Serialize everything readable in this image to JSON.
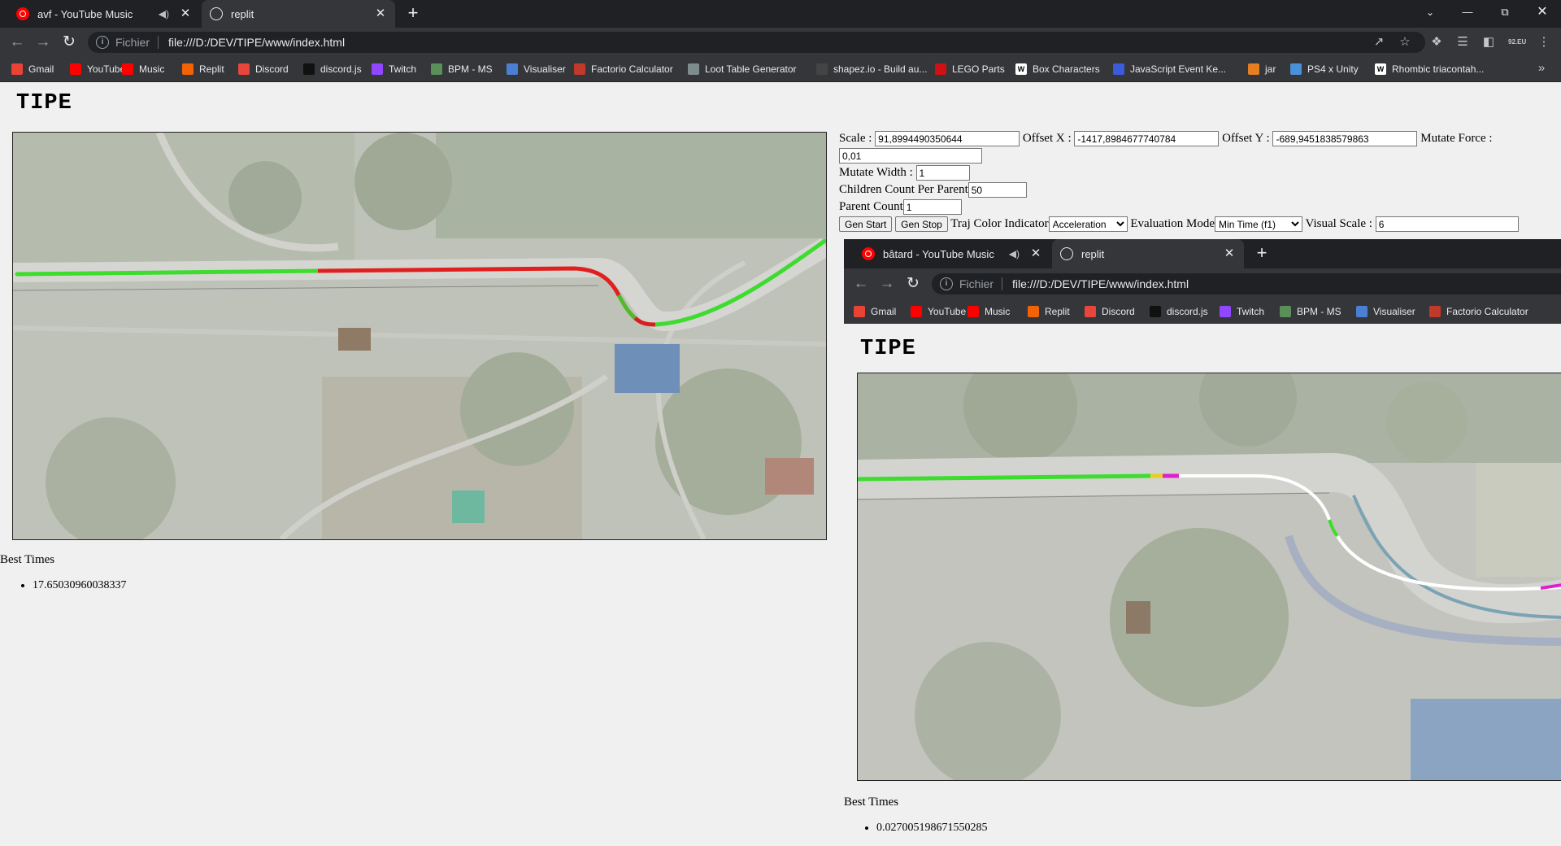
{
  "browser": {
    "tabs": [
      {
        "title": "avf - YouTube Music",
        "active": false
      },
      {
        "title": "replit",
        "active": true
      }
    ],
    "address": {
      "scheme": "Fichier",
      "url": "file:///D:/DEV/TIPE/www/index.html"
    },
    "bookmarks": [
      {
        "label": "Gmail",
        "icon": "gmail-icon",
        "color": "#ea4335"
      },
      {
        "label": "YouTube",
        "icon": "youtube-icon",
        "color": "#ff0000"
      },
      {
        "label": "Music",
        "icon": "youtube-music-icon",
        "color": "#ff0000"
      },
      {
        "label": "Replit",
        "icon": "replit-icon",
        "color": "#f26207"
      },
      {
        "label": "Discord",
        "icon": "discord-icon",
        "color": "#e8453c"
      },
      {
        "label": "discord.js",
        "icon": "discordjs-icon",
        "color": "#111111"
      },
      {
        "label": "Twitch",
        "icon": "twitch-icon",
        "color": "#9146ff"
      },
      {
        "label": "BPM - MS",
        "icon": "bpm-icon",
        "color": "#5a8f5a"
      },
      {
        "label": "Visualiser",
        "icon": "visualiser-icon",
        "color": "#4a7fd4"
      },
      {
        "label": "Factorio Calculator",
        "icon": "factorio-icon",
        "color": "#c0392b"
      },
      {
        "label": "Loot Table Generator",
        "icon": "loot-icon",
        "color": "#7f8c8d"
      },
      {
        "label": "shapez.io - Build au...",
        "icon": "shapez-icon",
        "color": "#444444"
      },
      {
        "label": "LEGO Parts",
        "icon": "lego-icon",
        "color": "#d01012"
      },
      {
        "label": "Box Characters",
        "icon": "wiki-icon",
        "color": "#ffffff"
      },
      {
        "label": "JavaScript Event Ke...",
        "icon": "js-event-icon",
        "color": "#3b5bdb"
      },
      {
        "label": "jar",
        "icon": "jar-icon",
        "color": "#e67e22"
      },
      {
        "label": "PS4 x Unity",
        "icon": "wordpress-icon",
        "color": "#4a90d9"
      },
      {
        "label": "Rhombic triacontah...",
        "icon": "wiki-icon",
        "color": "#ffffff"
      }
    ]
  },
  "page": {
    "title": "TIPE",
    "best_times_label": "Best Times",
    "best_times": [
      "17.65030960038337"
    ]
  },
  "controls": {
    "scale_label": "Scale :",
    "scale_value": "91,8994490350644",
    "offset_x_label": "Offset X :",
    "offset_x_value": "-1417,8984677740784",
    "offset_y_label": "Offset Y :",
    "offset_y_value": "-689,9451838579863",
    "mutate_force_label": "Mutate Force :",
    "mutate_force_value": "0,01",
    "mutate_width_label": "Mutate Width :",
    "mutate_width_value": "1",
    "children_label": "Children Count Per Parent",
    "children_value": "50",
    "parent_label": "Parent Count",
    "parent_value": "1",
    "gen_start": "Gen Start",
    "gen_stop": "Gen Stop",
    "traj_label": "Traj Color Indicator",
    "traj_value": "Acceleration",
    "eval_label": "Evaluation Mode",
    "eval_value": "Min Time (f1)",
    "visual_scale_label": "Visual Scale :",
    "visual_scale_value": "6"
  },
  "nested": {
    "tabs": [
      {
        "title": "bâtard - YouTube Music",
        "active": false
      },
      {
        "title": "replit",
        "active": true
      }
    ],
    "address": {
      "scheme": "Fichier",
      "url": "file:///D:/DEV/TIPE/www/index.html"
    },
    "bookmarks": [
      {
        "label": "Gmail",
        "icon": "gmail-icon",
        "color": "#ea4335"
      },
      {
        "label": "YouTube",
        "icon": "youtube-icon",
        "color": "#ff0000"
      },
      {
        "label": "Music",
        "icon": "youtube-music-icon",
        "color": "#ff0000"
      },
      {
        "label": "Replit",
        "icon": "replit-icon",
        "color": "#f26207"
      },
      {
        "label": "Discord",
        "icon": "discord-icon",
        "color": "#e8453c"
      },
      {
        "label": "discord.js",
        "icon": "discordjs-icon",
        "color": "#111111"
      },
      {
        "label": "Twitch",
        "icon": "twitch-icon",
        "color": "#9146ff"
      },
      {
        "label": "BPM - MS",
        "icon": "bpm-icon",
        "color": "#5a8f5a"
      },
      {
        "label": "Visualiser",
        "icon": "visualiser-icon",
        "color": "#4a7fd4"
      },
      {
        "label": "Factorio Calculator",
        "icon": "factorio-icon",
        "color": "#c0392b"
      }
    ],
    "page_title": "TIPE",
    "best_times_label": "Best Times",
    "best_times": [
      "0.027005198671550285"
    ]
  },
  "colors": {
    "track_green": "#3ddc2f",
    "track_red": "#e0201e",
    "track_white": "#ffffff",
    "track_magenta": "#e020d0",
    "chrome_dark": "#202124",
    "chrome_toolbar": "#35363a"
  }
}
